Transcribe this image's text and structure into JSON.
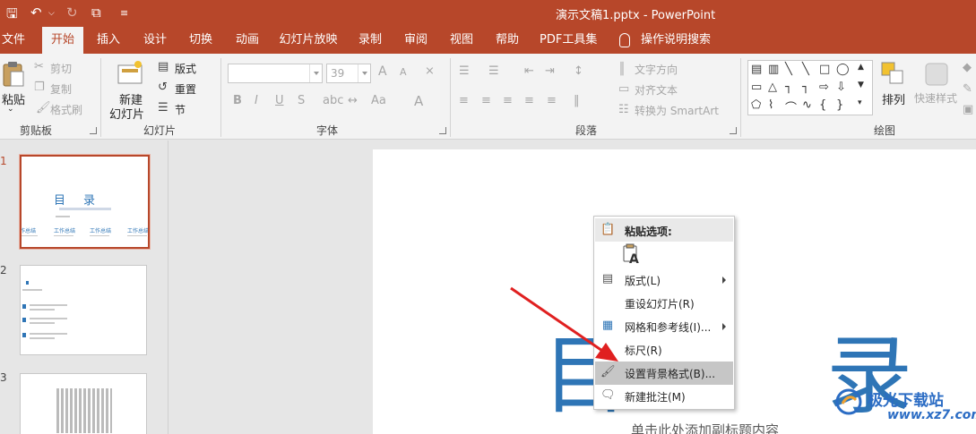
{
  "app": {
    "title": "演示文稿1.pptx - PowerPoint"
  },
  "quick_access": {
    "save_icon": "save-icon",
    "undo_icon": "undo-icon",
    "redo_icon": "redo-icon",
    "present_icon": "start-from-beginning-icon",
    "customize_icon": "customize-toolbar-icon"
  },
  "tabs": [
    {
      "label": "文件"
    },
    {
      "label": "开始"
    },
    {
      "label": "插入"
    },
    {
      "label": "设计"
    },
    {
      "label": "切换"
    },
    {
      "label": "动画"
    },
    {
      "label": "幻灯片放映"
    },
    {
      "label": "录制"
    },
    {
      "label": "审阅"
    },
    {
      "label": "视图"
    },
    {
      "label": "帮助"
    },
    {
      "label": "PDF工具集"
    },
    {
      "label": "操作说明搜索"
    }
  ],
  "ribbon": {
    "clipboard": {
      "paste": "粘贴",
      "cut": "剪切",
      "copy": "复制",
      "format_painter": "格式刷",
      "label": "剪贴板"
    },
    "slides": {
      "new_slide_line1": "新建",
      "new_slide_line2": "幻灯片",
      "layout": "版式",
      "reset": "重置",
      "section": "节",
      "label": "幻灯片"
    },
    "font": {
      "size": "39",
      "label": "字体",
      "bold": "B",
      "italic": "I",
      "underline": "U",
      "strike": "S",
      "grow": "A",
      "shrink": "A",
      "case": "Aa",
      "color": "A"
    },
    "paragraph": {
      "text_direction": "文字方向",
      "align_text": "对齐文本",
      "smartart": "转换为 SmartArt",
      "label": "段落"
    },
    "drawing": {
      "arrange": "排列",
      "quick_styles": "快速样式",
      "label": "绘图"
    }
  },
  "slides": [
    {
      "number": "1",
      "title": "目录",
      "items": [
        "作总结",
        "工作总结",
        "工作总结",
        "工作总结"
      ]
    },
    {
      "number": "2"
    },
    {
      "number": "3"
    }
  ],
  "canvas": {
    "title_left": "目",
    "title_right": "录",
    "subtitle_placeholder": "单击此处添加副标题内容"
  },
  "context_menu": {
    "header": "粘贴选项:",
    "paste_option_letter": "A",
    "items": [
      {
        "label": "版式(L)",
        "submenu": true
      },
      {
        "label": "重设幻灯片(R)",
        "submenu": false
      },
      {
        "label": "网格和参考线(I)...",
        "submenu": true
      },
      {
        "label": "标尺(R)",
        "submenu": false
      },
      {
        "label": "设置背景格式(B)...",
        "submenu": false,
        "highlighted": true
      },
      {
        "label": "新建批注(M)",
        "submenu": false
      }
    ]
  },
  "watermark": {
    "name": "极光下载站",
    "url": "www.xz7.com"
  },
  "colors": {
    "brand": "#b7472a",
    "accent_blue": "#2e75b6",
    "arrow": "#e02020"
  }
}
